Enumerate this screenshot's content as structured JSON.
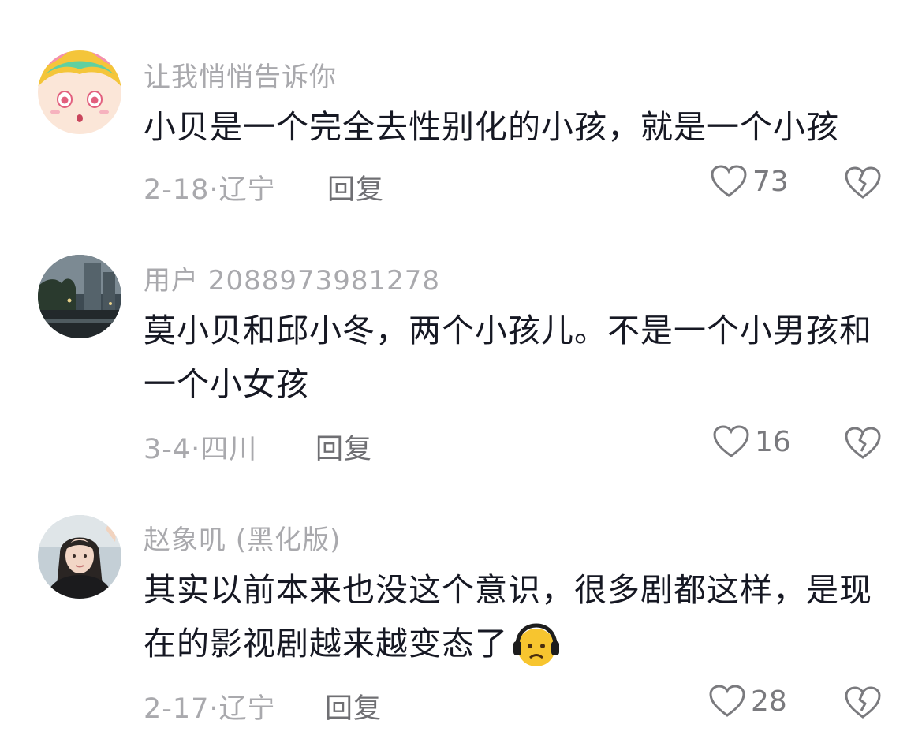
{
  "comments": [
    {
      "username": "让我悄悄告诉你",
      "text": "小贝是一个完全去性别化的小孩，就是一个小孩",
      "date_location": "2-18·辽宁",
      "reply_label": "回复",
      "likes": "73",
      "avatar_icon": "anime-girl-avatar"
    },
    {
      "username": "用户 2088973981278",
      "text": "莫小贝和邱小冬，两个小孩儿。不是一个小男孩和一个小女孩",
      "date_location": "3-4·四川",
      "reply_label": "回复",
      "likes": "16",
      "avatar_icon": "night-city-avatar"
    },
    {
      "username": "赵象叽 (黑化版)",
      "text": "其实以前本来也没这个意识，很多剧都这样，是现在的影视剧越来越变态了",
      "emoji": "worried-face-emoji",
      "date_location": "2-17·辽宁",
      "reply_label": "回复",
      "likes": "28",
      "avatar_icon": "girl-photo-avatar"
    }
  ],
  "colors": {
    "text": "#161823",
    "secondary": "#a9a9ad",
    "reply": "#6f6f73",
    "icon": "#7a7a7e"
  }
}
